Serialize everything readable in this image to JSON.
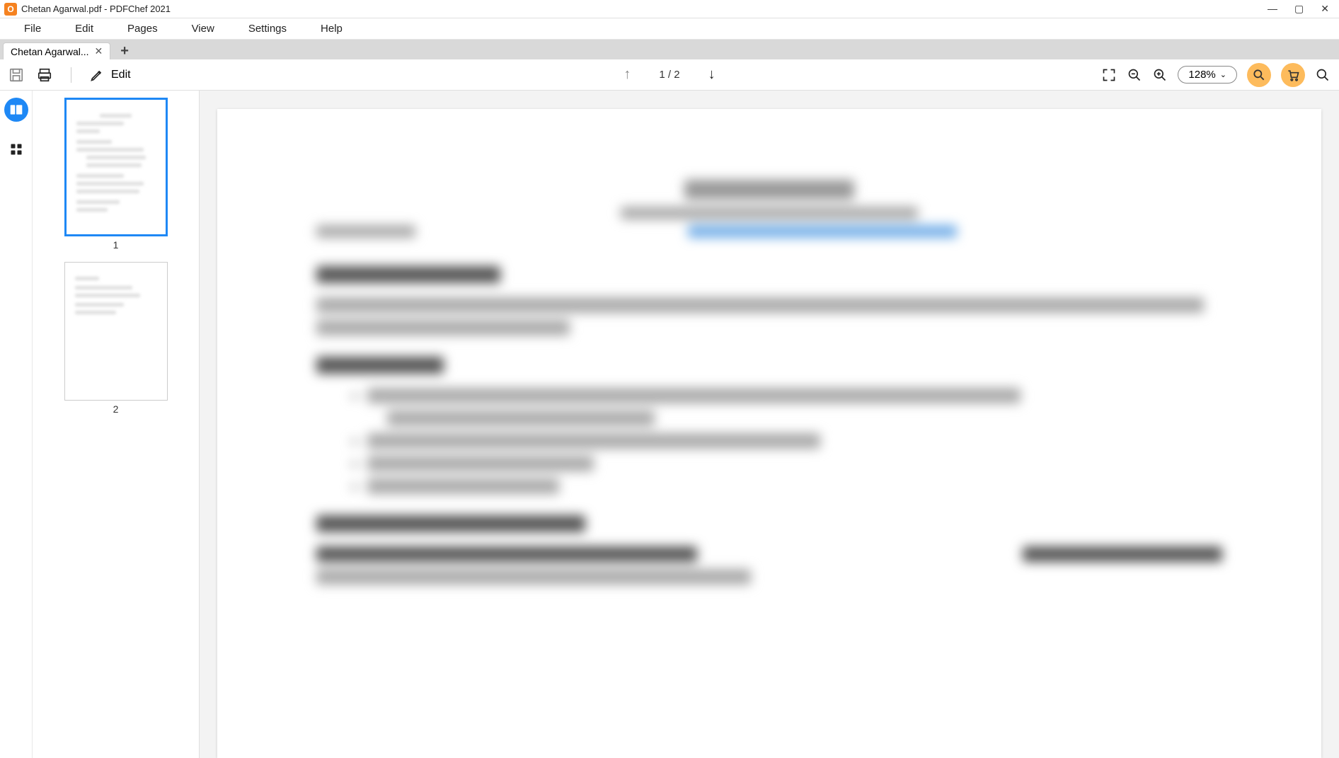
{
  "titlebar": {
    "title": "Chetan Agarwal.pdf - PDFChef 2021",
    "app_glyph": "O"
  },
  "menu": {
    "items": [
      "File",
      "Edit",
      "Pages",
      "View",
      "Settings",
      "Help"
    ]
  },
  "tabs": {
    "items": [
      {
        "label": "Chetan Agarwal..."
      }
    ]
  },
  "toolbar": {
    "edit_label": "Edit",
    "page_indicator": "1 / 2",
    "zoom_label": "128%"
  },
  "thumbnails": {
    "pages": [
      {
        "num": "1",
        "selected": true
      },
      {
        "num": "2",
        "selected": false
      }
    ]
  },
  "document": {
    "page": 1,
    "total_pages": 2,
    "sections_visible": [
      "Career Objective",
      "Scholastics",
      "Organizational Experience"
    ]
  },
  "colors": {
    "accent": "#1e88f5",
    "highlight": "#fdbb5c",
    "brand": "#f58220"
  }
}
